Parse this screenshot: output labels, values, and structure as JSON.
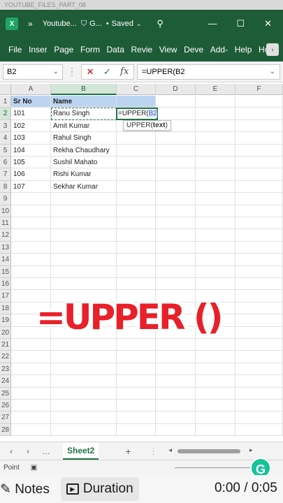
{
  "window": {
    "top_clip_text": "YOUTUBE_FILES_PART_08",
    "app_icon": "X",
    "doc_title": "Youtube...",
    "shield_label": "G...",
    "saved_label": "Saved",
    "saved_dot": "•"
  },
  "ribbon": {
    "tabs": [
      "File",
      "Inser",
      "Page",
      "Form",
      "Data",
      "Revie",
      "View",
      "Deve",
      "Add-",
      "Help",
      "Hom"
    ]
  },
  "formula_bar": {
    "name_box": "B2",
    "formula": "=UPPER(B2"
  },
  "sheet": {
    "columns": [
      "A",
      "B",
      "C",
      "D",
      "E",
      "F"
    ],
    "rows": [
      "1",
      "2",
      "3",
      "4",
      "5",
      "6",
      "7",
      "8",
      "9",
      "10",
      "11",
      "12",
      "13",
      "14",
      "15",
      "16",
      "17",
      "18",
      "19",
      "20",
      "21",
      "22",
      "23",
      "24",
      "25",
      "26",
      "27",
      "28"
    ],
    "header": {
      "a": "Sr No",
      "b": "Name"
    },
    "data": [
      {
        "a": "101",
        "b": "Ranu Singh"
      },
      {
        "a": "102",
        "b": "Amit Kumar"
      },
      {
        "a": "103",
        "b": "Rahul Singh"
      },
      {
        "a": "104",
        "b": "Rekha Chaudhary"
      },
      {
        "a": "105",
        "b": "Sushil Mahato"
      },
      {
        "a": "106",
        "b": "Rishi Kumar"
      },
      {
        "a": "107",
        "b": "Sekhar Kumar"
      }
    ],
    "edit_prefix": "=UPPER(",
    "edit_ref": "B2",
    "tooltip_fn": "UPPER(",
    "tooltip_arg": "text",
    "tooltip_close": ")"
  },
  "overlay_text": "=UPPER ()",
  "sheet_tabs": {
    "active": "Sheet2"
  },
  "status": {
    "mode": "Point"
  },
  "video_bar": {
    "notes": "Notes",
    "duration": "Duration",
    "time": "0:00 / 0:05"
  },
  "colors": {
    "excel_green": "#1e5c38",
    "header_fill": "#bcd4f0",
    "overlay_red": "#e8202a"
  }
}
